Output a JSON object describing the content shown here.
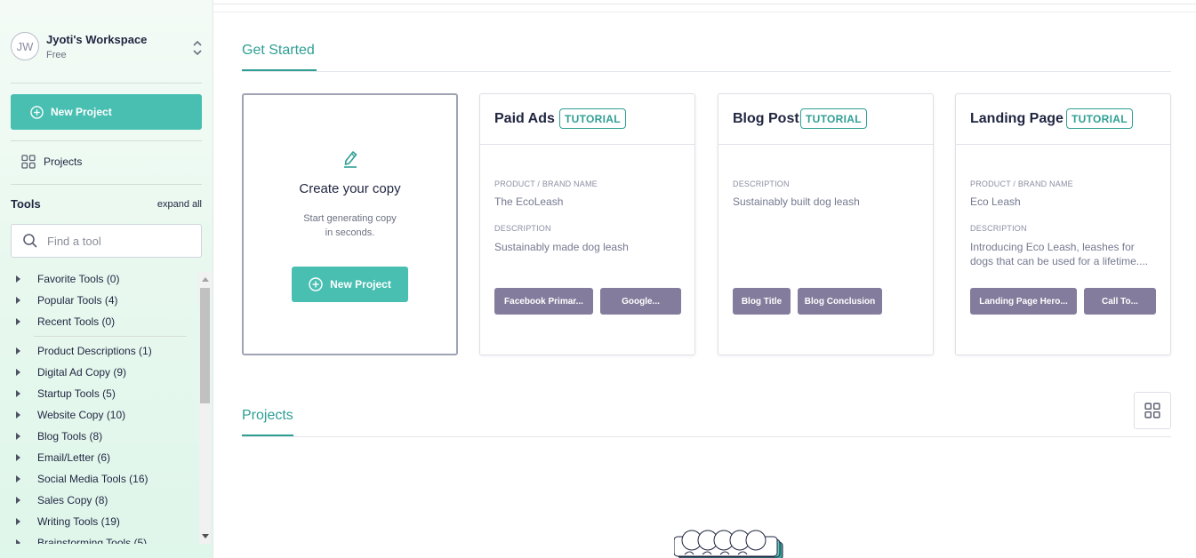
{
  "sidebar": {
    "workspace": {
      "initials": "JW",
      "name": "Jyoti's Workspace",
      "plan": "Free"
    },
    "new_project_label": "New Project",
    "projects_label": "Projects",
    "tools_title": "Tools",
    "expand_all_label": "expand all",
    "search_placeholder": "Find a tool",
    "tool_groups_top": [
      {
        "label": "Favorite Tools (0)"
      },
      {
        "label": "Popular Tools (4)"
      },
      {
        "label": "Recent Tools (0)"
      }
    ],
    "tool_groups": [
      {
        "label": "Product Descriptions (1)"
      },
      {
        "label": "Digital Ad Copy (9)"
      },
      {
        "label": "Startup Tools (5)"
      },
      {
        "label": "Website Copy (10)"
      },
      {
        "label": "Blog Tools (8)"
      },
      {
        "label": "Email/Letter (6)"
      },
      {
        "label": "Social Media Tools (16)"
      },
      {
        "label": "Sales Copy (8)"
      },
      {
        "label": "Writing Tools (19)"
      },
      {
        "label": "Brainstorming Tools (5)"
      }
    ]
  },
  "main": {
    "get_started_title": "Get Started",
    "create_card": {
      "title": "Create your copy",
      "subtitle_line1": "Start generating copy",
      "subtitle_line2": "in seconds.",
      "button_label": "New Project"
    },
    "tutorial_badge": "TUTORIAL",
    "tutorial_cards": [
      {
        "name": "Paid Ads",
        "fields": [
          {
            "label": "PRODUCT / BRAND NAME",
            "value": "The EcoLeash"
          },
          {
            "label": "DESCRIPTION",
            "value": "Sustainably made dog leash"
          }
        ],
        "chips": [
          "Facebook Primar...",
          "Google..."
        ]
      },
      {
        "name": "Blog Post",
        "fields": [
          {
            "label": "DESCRIPTION",
            "value": "Sustainably built dog leash"
          }
        ],
        "chips": [
          "Blog Title",
          "Blog Conclusion"
        ]
      },
      {
        "name": "Landing Page",
        "fields": [
          {
            "label": "PRODUCT / BRAND NAME",
            "value": "Eco Leash"
          },
          {
            "label": "DESCRIPTION",
            "value": "Introducing Eco Leash, leashes for dogs that can be used for a lifetime...."
          }
        ],
        "chips": [
          "Landing Page Hero...",
          "Call To..."
        ]
      }
    ],
    "projects_title": "Projects"
  },
  "colors": {
    "accent": "#49bfb2",
    "accent_text": "#2f9f94",
    "chip": "#837c9c",
    "sidebar_bg": "#e7f8ee"
  }
}
